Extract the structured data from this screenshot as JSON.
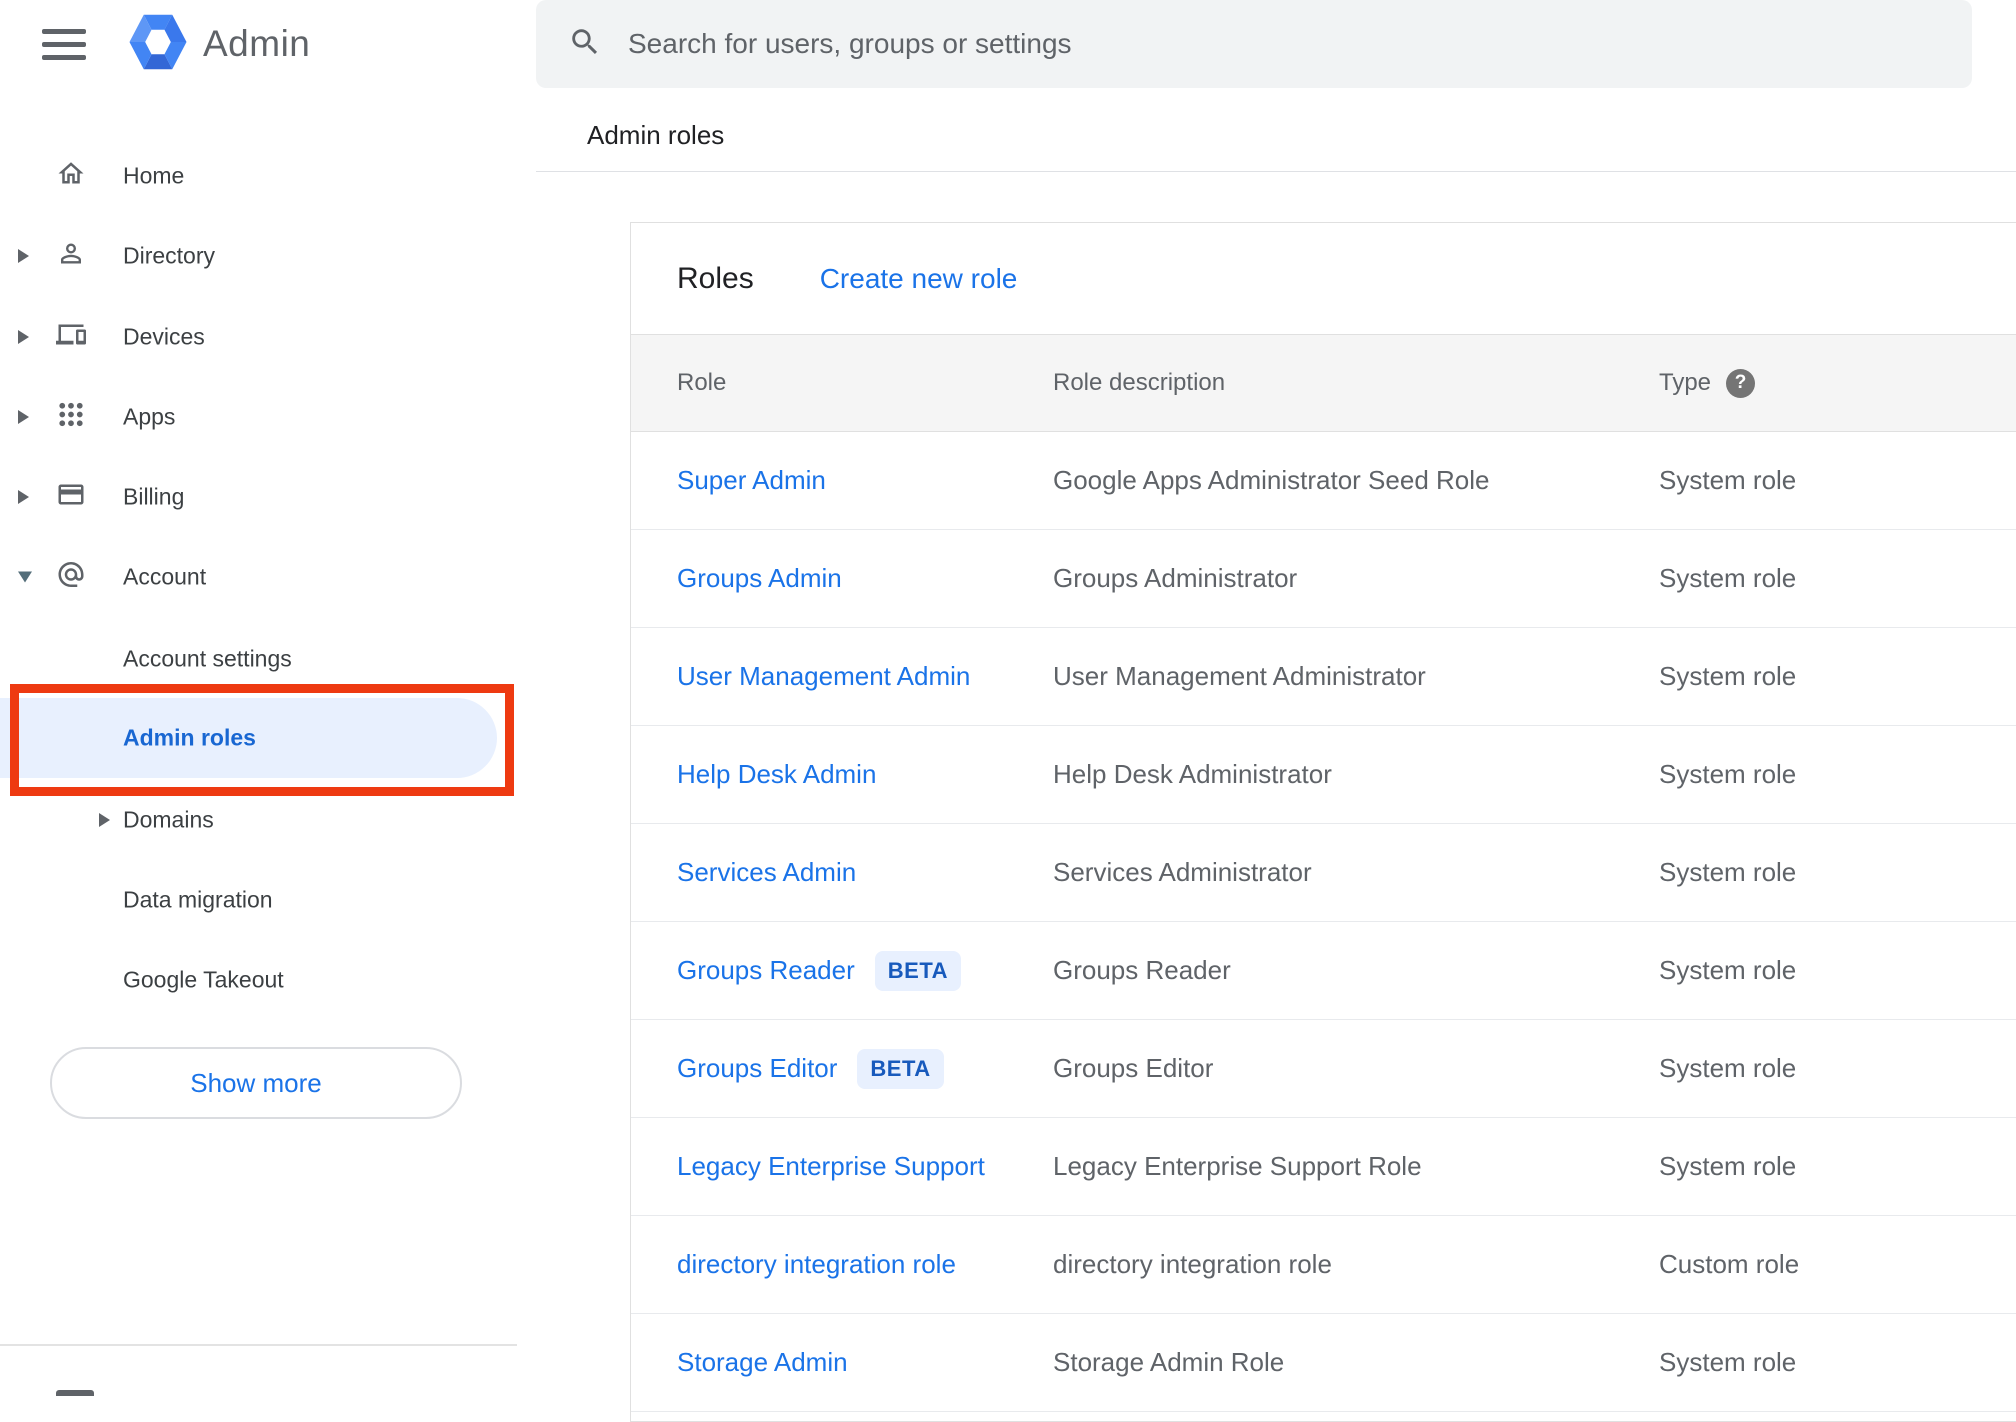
{
  "app": {
    "title": "Admin"
  },
  "header": {
    "search_placeholder": "Search for users, groups or settings",
    "breadcrumb": "Admin roles"
  },
  "sidebar": {
    "items": [
      {
        "label": "Home"
      },
      {
        "label": "Directory"
      },
      {
        "label": "Devices"
      },
      {
        "label": "Apps"
      },
      {
        "label": "Billing"
      },
      {
        "label": "Account"
      }
    ],
    "account_subitems": [
      {
        "label": "Account settings"
      },
      {
        "label": "Admin roles",
        "active": true
      },
      {
        "label": "Domains"
      },
      {
        "label": "Data migration"
      },
      {
        "label": "Google Takeout"
      }
    ],
    "show_more_label": "Show more"
  },
  "main": {
    "card_title": "Roles",
    "create_role_label": "Create new role",
    "table": {
      "columns": [
        "Role",
        "Role description",
        "Type"
      ],
      "help_glyph": "?",
      "rows": [
        {
          "role": "Super Admin",
          "description": "Google Apps Administrator Seed Role",
          "type": "System role"
        },
        {
          "role": "Groups Admin",
          "description": "Groups Administrator",
          "type": "System role"
        },
        {
          "role": "User Management Admin",
          "description": "User Management Administrator",
          "type": "System role"
        },
        {
          "role": "Help Desk Admin",
          "description": "Help Desk Administrator",
          "type": "System role"
        },
        {
          "role": "Services Admin",
          "description": "Services Administrator",
          "type": "System role"
        },
        {
          "role": "Groups Reader",
          "beta_label": "BETA",
          "description": "Groups Reader",
          "type": "System role"
        },
        {
          "role": "Groups Editor",
          "beta_label": "BETA",
          "description": "Groups Editor",
          "type": "System role"
        },
        {
          "role": "Legacy Enterprise Support",
          "description": "Legacy Enterprise Support Role",
          "type": "System role"
        },
        {
          "role": "directory integration role",
          "description": "directory integration role",
          "type": "Custom role"
        },
        {
          "role": "Storage Admin",
          "description": "Storage Admin Role",
          "type": "System role"
        }
      ]
    }
  },
  "colors": {
    "link_blue": "#1a73e8",
    "active_item_blue": "#1967d2",
    "annotation_red": "#ee3a11",
    "beta_badge_bg": "#e8f0fe",
    "beta_badge_text": "#185abc",
    "icon_gray": "#5f6368",
    "table_header_bg": "#f5f5f5",
    "search_bg": "#f1f3f4",
    "logo_blue": "#4285f4"
  }
}
